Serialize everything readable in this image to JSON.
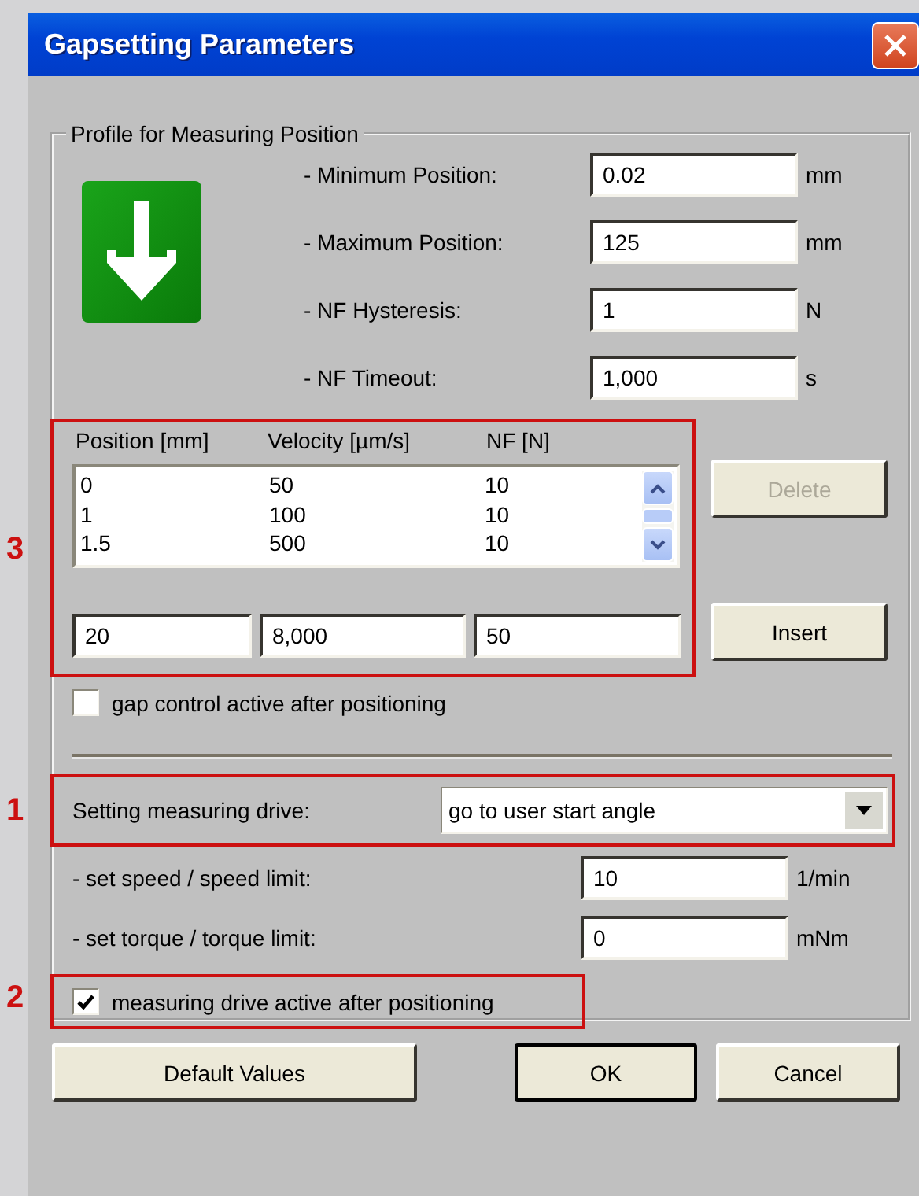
{
  "window": {
    "title": "Gapsetting Parameters"
  },
  "profile": {
    "title": "Profile for Measuring Position",
    "fields": [
      {
        "label": "- Minimum Position:",
        "value": "0.02",
        "unit": "mm"
      },
      {
        "label": "- Maximum Position:",
        "value": "125",
        "unit": "mm"
      },
      {
        "label": "- NF Hysteresis:",
        "value": "1",
        "unit": "N"
      },
      {
        "label": "- NF Timeout:",
        "value": "1,000",
        "unit": "s"
      }
    ],
    "table": {
      "callout": "3",
      "columns": [
        "Position [mm]",
        "Velocity [µm/s]",
        "NF [N]"
      ],
      "rows": [
        [
          "0",
          "50",
          "10"
        ],
        [
          "1",
          "100",
          "10"
        ],
        [
          "1.5",
          "500",
          "10"
        ]
      ],
      "inputs": [
        "20",
        "8,000",
        "50"
      ]
    },
    "delete_button": {
      "label": "Delete",
      "disabled": true
    },
    "insert_button": {
      "label": "Insert",
      "disabled": false
    },
    "gap_control": {
      "label": "gap control active after positioning",
      "checked": false
    },
    "drive": {
      "callout": "1",
      "label": "Setting measuring drive:",
      "value": "go to user start angle"
    },
    "limits": [
      {
        "label": "- set speed / speed limit:",
        "value": "10",
        "unit": "1/min"
      },
      {
        "label": "- set torque / torque limit:",
        "value": "0",
        "unit": "mNm"
      }
    ],
    "drive_active": {
      "callout": "2",
      "label": "measuring drive active after positioning",
      "checked": true
    }
  },
  "buttons": [
    {
      "label": "Default Values",
      "default": false
    },
    {
      "label": "OK",
      "default": true
    },
    {
      "label": "Cancel",
      "default": false
    }
  ]
}
